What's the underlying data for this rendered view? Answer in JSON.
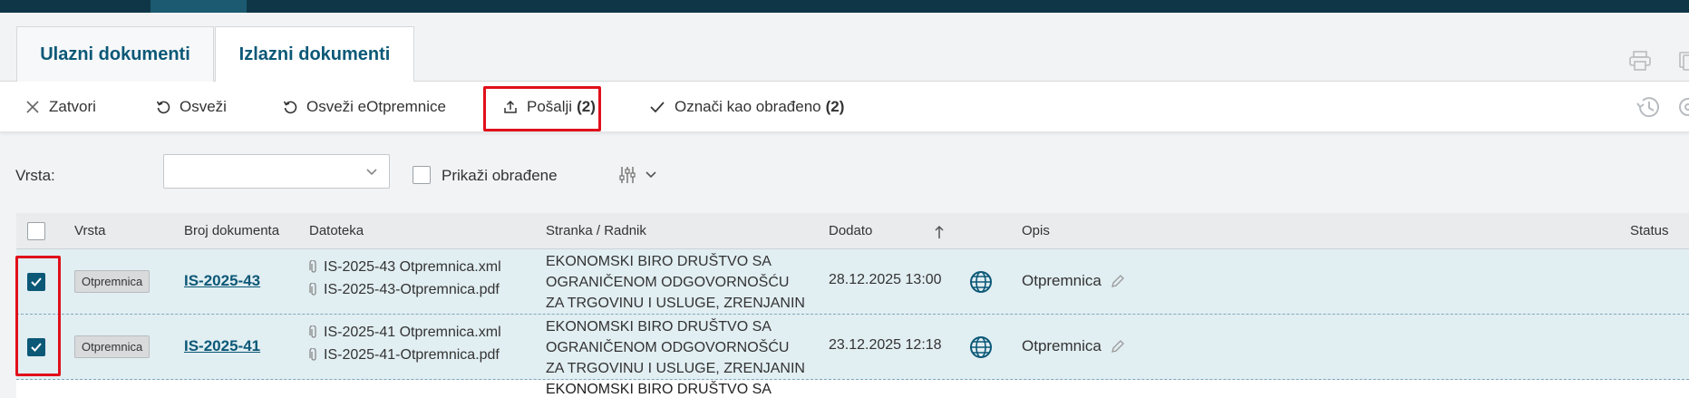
{
  "tabs": [
    {
      "label": "Ulazni dokumenti",
      "active": false
    },
    {
      "label": "Izlazni dokumenti",
      "active": true
    }
  ],
  "toolbar": {
    "close_label": "Zatvori",
    "refresh_label": "Osveži",
    "refresh_edelivery_label": "Osveži eOtpremnice",
    "send_label": "Pošalji",
    "send_count": "(2)",
    "mark_processed_label": "Označi kao obrađeno",
    "mark_processed_count": "(2)"
  },
  "filter": {
    "type_label": "Vrsta:",
    "type_value": "",
    "show_processed_label": "Prikaži obrađene"
  },
  "table": {
    "headers": {
      "vrsta": "Vrsta",
      "broj": "Broj dokumenta",
      "datoteka": "Datoteka",
      "stranka": "Stranka / Radnik",
      "dodato": "Dodato",
      "opis": "Opis",
      "status": "Status"
    },
    "rows": [
      {
        "checked": true,
        "type": "Otpremnica",
        "doc_number": "IS-2025-43",
        "file1": "IS-2025-43 Otpremnica.xml",
        "file2": "IS-2025-43-Otpremnica.pdf",
        "party_line1": "EKONOMSKI BIRO DRUŠTVO SA",
        "party_line2": "OGRANIČENOM ODGOVORNOŠĆU",
        "party_line3": "ZA TRGOVINU I USLUGE, ZRENJANIN",
        "added": "28.12.2025 13:00",
        "description": "Otpremnica"
      },
      {
        "checked": true,
        "type": "Otpremnica",
        "doc_number": "IS-2025-41",
        "file1": "IS-2025-41 Otpremnica.xml",
        "file2": "IS-2025-41-Otpremnica.pdf",
        "party_line1": "EKONOMSKI BIRO DRUŠTVO SA",
        "party_line2": "OGRANIČENOM ODGOVORNOŠĆU",
        "party_line3": "ZA TRGOVINU I USLUGE, ZRENJANIN",
        "added": "23.12.2025 12:18",
        "description": "Otpremnica"
      }
    ],
    "partial_row_text": "EKONOMSKI BIRO DRUŠTVO SA"
  },
  "colors": {
    "accent": "#0b5877",
    "header_bar": "#0e3646",
    "highlight": "#e0101a",
    "selected_row": "#e1eef2"
  }
}
